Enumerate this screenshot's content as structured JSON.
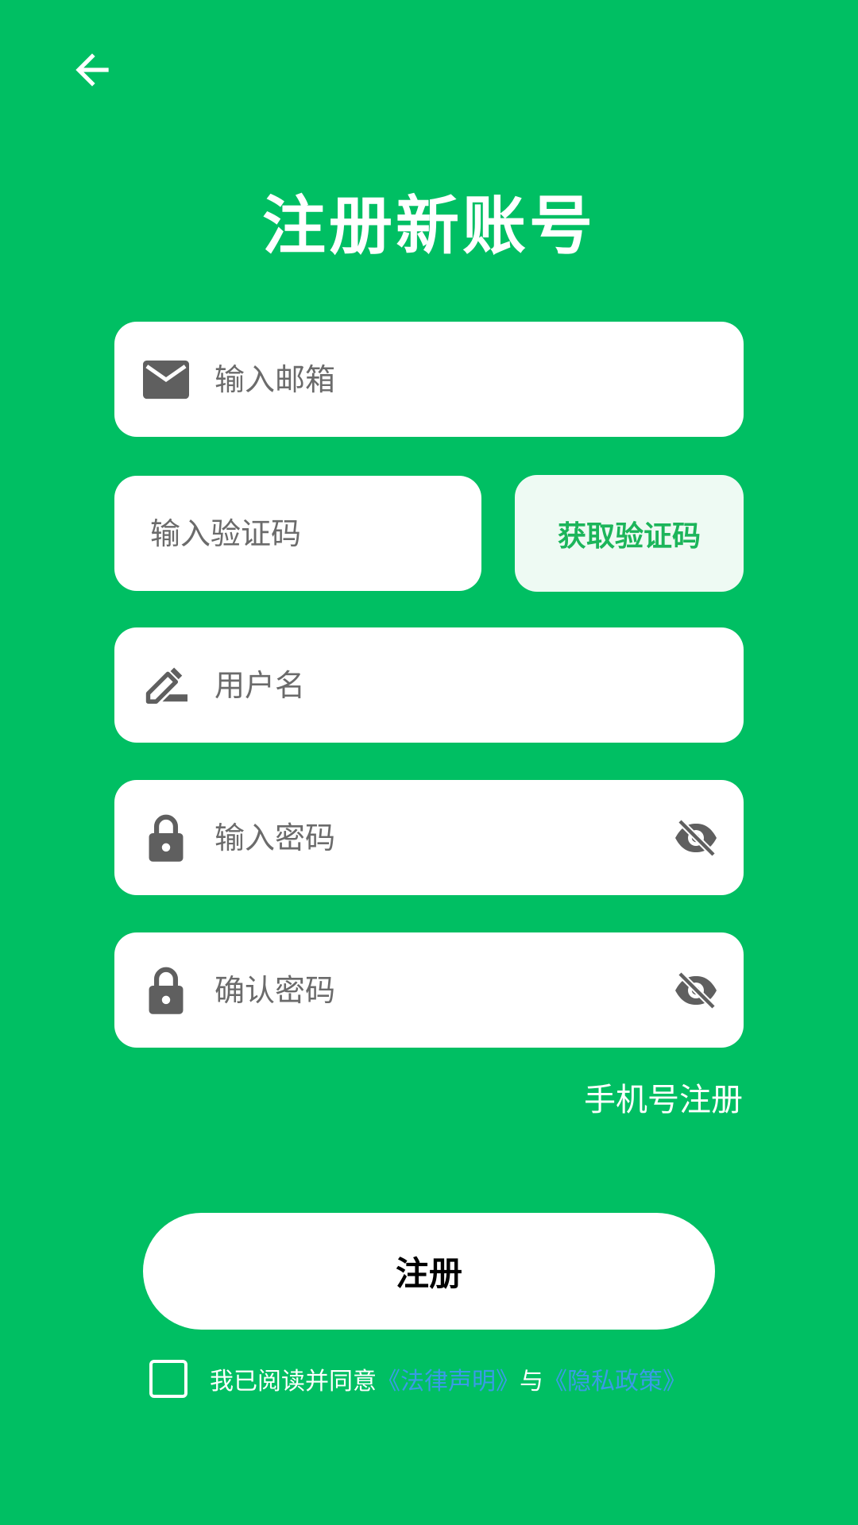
{
  "header": {
    "title": "注册新账号"
  },
  "form": {
    "email_placeholder": "输入邮箱",
    "code_placeholder": "输入验证码",
    "get_code_label": "获取验证码",
    "username_placeholder": "用户名",
    "password_placeholder": "输入密码",
    "confirm_password_placeholder": "确认密码"
  },
  "links": {
    "phone_register": "手机号注册"
  },
  "actions": {
    "register_label": "注册"
  },
  "agreement": {
    "prefix": "我已阅读并同意",
    "legal_link": "《法律声明》",
    "conjunction": "与",
    "privacy_link": "《隐私政策》",
    "checked": false
  },
  "icons": {
    "back": "arrow-left-icon",
    "email": "mail-icon",
    "username": "edit-icon",
    "password": "lock-icon",
    "visibility": "eye-off-icon"
  },
  "colors": {
    "background": "#00bf63",
    "field": "#ffffff",
    "code_button_bg": "#eefaf3",
    "code_button_text": "#1cb55a",
    "link": "#3a9be6",
    "icon": "#5f5f5f"
  }
}
